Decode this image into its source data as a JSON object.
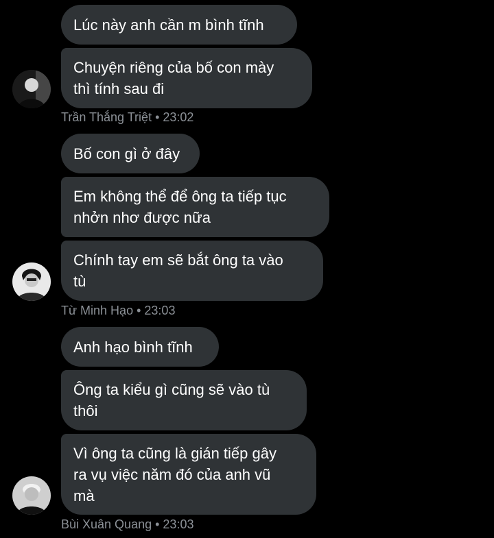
{
  "colors": {
    "background": "#000000",
    "bubble": "#2f3336",
    "text": "#ffffff",
    "meta": "#8b9096"
  },
  "groups": [
    {
      "messages": [
        {
          "lines": [
            "Lúc này anh cần m bình tĩnh"
          ]
        },
        {
          "lines": [
            "Chuyện riêng của bố con mày",
            "thì tính sau đi"
          ]
        }
      ],
      "sender": "Trần Thắng Triệt",
      "time": "23:02",
      "avatar_icon": "person-avatar-icon"
    },
    {
      "messages": [
        {
          "lines": [
            "Bố con gì ở đây"
          ]
        },
        {
          "lines": [
            "Em không thể để ông ta tiếp tục",
            "nhởn nhơ được nữa"
          ]
        },
        {
          "lines": [
            "Chính tay em sẽ bắt ông ta vào",
            "tù"
          ]
        }
      ],
      "sender": "Từ Minh Hạo",
      "time": "23:03",
      "avatar_icon": "person-avatar-icon"
    },
    {
      "messages": [
        {
          "lines": [
            "Anh hạo bình tĩnh"
          ]
        },
        {
          "lines": [
            "Ông ta kiểu gì cũng sẽ vào tù",
            "thôi"
          ]
        },
        {
          "lines": [
            "Vì ông ta cũng là gián tiếp gây",
            "ra vụ việc năm đó của anh vũ",
            "mà"
          ]
        }
      ],
      "sender": "Bùi Xuân Quang",
      "time": "23:03",
      "avatar_icon": "person-avatar-icon"
    }
  ],
  "separator": " • "
}
